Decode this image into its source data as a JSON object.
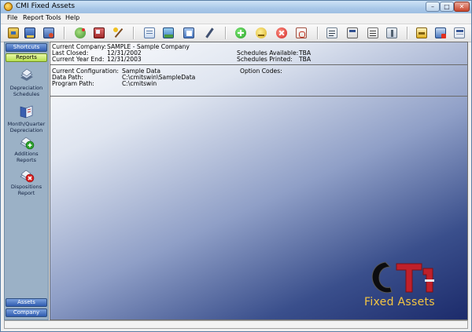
{
  "window": {
    "title": "CMI Fixed Assets",
    "minimize": "–",
    "maximize": "□",
    "close": "✕"
  },
  "menu": {
    "items": [
      "File",
      "Report",
      "Tools",
      "Help"
    ]
  },
  "toolbar": {
    "icons": [
      "tax-icon",
      "book-icon",
      "state-icon",
      "asset-add-icon",
      "asset-edit-icon",
      "wand-icon",
      "notebook-icon",
      "image-icon",
      "folder-icon",
      "pen-icon",
      "add-green-icon",
      "edit-yellow-icon",
      "delete-red-icon",
      "document-icon",
      "report-icon",
      "sheet-icon",
      "printer-doc-icon",
      "tools-icon",
      "export-icon",
      "calendar-icon"
    ]
  },
  "sidebar": {
    "shortcuts": "Shortcuts",
    "reports": "Reports",
    "items": [
      {
        "label": "Depreciation Schedules"
      },
      {
        "label": "Month/Quarter Depreciation"
      },
      {
        "label": "Additions Reports"
      },
      {
        "label": "Dispositions Report"
      }
    ],
    "assets": "Assets",
    "company": "Company"
  },
  "company": {
    "current_company_label": "Current Company:",
    "current_company_value": "SAMPLE - Sample Company",
    "last_closed_label": "Last Closed:",
    "last_closed_value": "12/31/2002",
    "year_end_label": "Current Year End:",
    "year_end_value": "12/31/2003",
    "schedules_available_label": "Schedules Available:",
    "schedules_available_value": "TBA",
    "schedules_printed_label": "Schedules Printed:",
    "schedules_printed_value": "TBA"
  },
  "config": {
    "configuration_label": "Current Configuration:",
    "configuration_value": "Sample Data",
    "option_codes_label": "Option Codes:",
    "data_path_label": "Data Path:",
    "data_path_value": "C:\\cmitswin\\SampleData",
    "program_path_label": "Program Path:",
    "program_path_value": "C:\\cmitswin"
  },
  "logo": {
    "text": "Fixed Assets"
  },
  "colors": {
    "accent": "#2f5bb0",
    "logo": "#f4c542",
    "logo_red": "#c0202a"
  }
}
